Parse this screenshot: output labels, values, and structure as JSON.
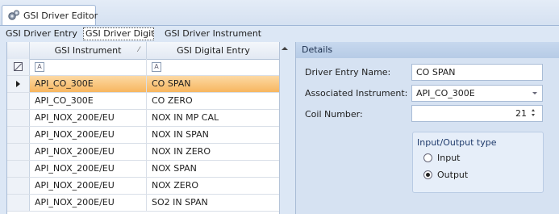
{
  "window": {
    "tab_title": "GSI Driver Editor",
    "icon": "gears-icon"
  },
  "subtabs": [
    {
      "label": "GSI Driver Entry",
      "active": false
    },
    {
      "label": "GSI Driver Digital",
      "active": true
    },
    {
      "label": "GSI Driver Instrument",
      "active": false
    }
  ],
  "grid": {
    "columns": [
      "GSI Instrument",
      "GSI Digital Entry"
    ],
    "sort_indicator": "⁄",
    "filter_icon_glyph": "A",
    "rows": [
      {
        "instrument": "API_CO_300E",
        "digital_entry": "CO SPAN",
        "selected": true
      },
      {
        "instrument": "API_CO_300E",
        "digital_entry": "CO ZERO",
        "selected": false
      },
      {
        "instrument": "API_NOX_200E/EU",
        "digital_entry": "NOX IN MP CAL",
        "selected": false
      },
      {
        "instrument": "API_NOX_200E/EU",
        "digital_entry": "NOX IN SPAN",
        "selected": false
      },
      {
        "instrument": "API_NOX_200E/EU",
        "digital_entry": "NOX IN ZERO",
        "selected": false
      },
      {
        "instrument": "API_NOX_200E/EU",
        "digital_entry": "NOX SPAN",
        "selected": false
      },
      {
        "instrument": "API_NOX_200E/EU",
        "digital_entry": "NOX ZERO",
        "selected": false
      },
      {
        "instrument": "API_NOX_200E/EU",
        "digital_entry": "SO2 IN SPAN",
        "selected": false
      }
    ]
  },
  "details": {
    "header": "Details",
    "driver_entry_name_label": "Driver Entry Name:",
    "driver_entry_name_value": "CO SPAN",
    "associated_instrument_label": "Associated Instrument:",
    "associated_instrument_value": "API_CO_300E",
    "coil_number_label": "Coil Number:",
    "coil_number_value": "21",
    "io_type": {
      "title": "Input/Output type",
      "options": [
        {
          "label": "Input",
          "selected": false
        },
        {
          "label": "Output",
          "selected": true
        }
      ]
    }
  },
  "colors": {
    "selected_row": "#f7b65f",
    "background": "#dce7f5"
  }
}
